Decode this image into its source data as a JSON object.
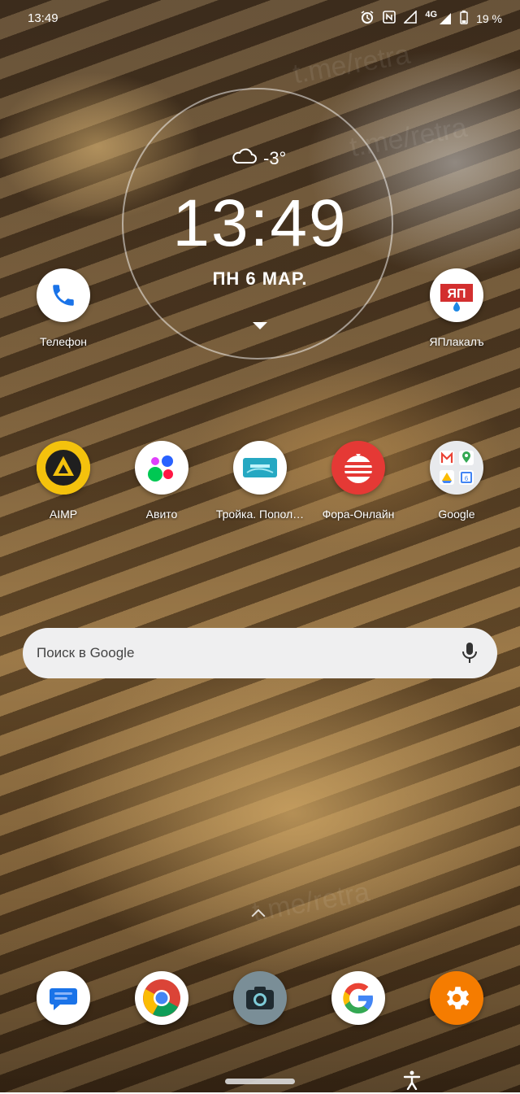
{
  "status_bar": {
    "time": "13:49",
    "network": "4G",
    "battery": "19 %",
    "icons": [
      "alarm-icon",
      "nfc-icon",
      "signal-icon",
      "signal-4g-icon",
      "battery-icon"
    ]
  },
  "clock_widget": {
    "weather_icon": "cloud-icon",
    "temperature": "-3°",
    "time": "13:49",
    "date": "ПН  6  МАР."
  },
  "top_apps": [
    {
      "name": "phone",
      "label": "Телефон",
      "icon": "phone-icon"
    },
    {
      "name": "yaplakal",
      "label": "ЯПлакалъ",
      "icon": "yaplakal-logo-icon"
    }
  ],
  "app_row": [
    {
      "label": "AIMP",
      "icon": "aimp-icon"
    },
    {
      "label": "Авито",
      "icon": "avito-icon"
    },
    {
      "label": "Тройка. Попол…",
      "icon": "troika-icon"
    },
    {
      "label": "Фора-Онлайн",
      "icon": "fora-icon"
    },
    {
      "label": "Google",
      "icon": "google-folder-icon"
    }
  ],
  "search": {
    "placeholder": "Поиск в Google",
    "mic_icon": "mic-icon"
  },
  "dock": [
    {
      "icon": "messages-icon"
    },
    {
      "icon": "chrome-icon"
    },
    {
      "icon": "camera-icon"
    },
    {
      "icon": "google-icon"
    },
    {
      "icon": "settings-icon"
    }
  ],
  "watermark": "t.me/retra",
  "colors": {
    "search_bg": "#efeff0",
    "phone_blue": "#1a73e8",
    "settings_orange": "#f57c00",
    "aimp_yellow": "#f4c20d"
  }
}
